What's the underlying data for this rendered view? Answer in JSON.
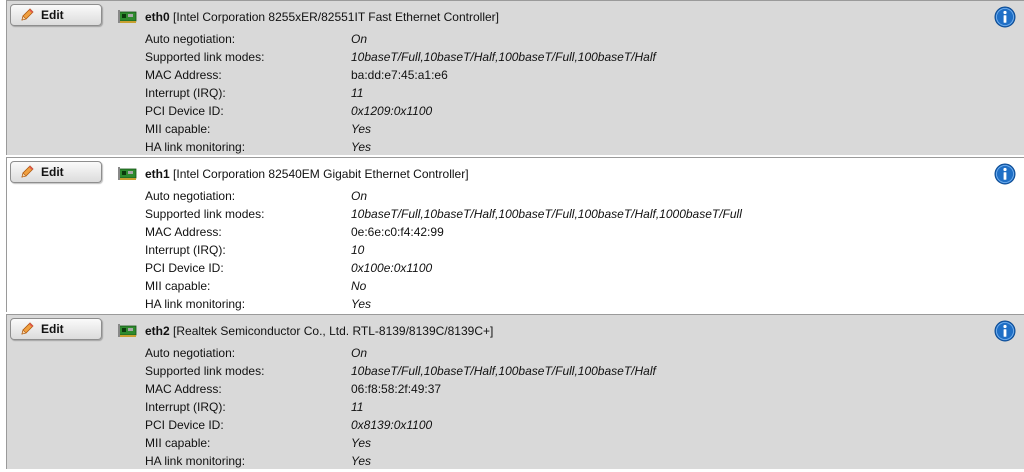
{
  "edit_label": "Edit",
  "property_labels": {
    "auto_negotiation": "Auto negotiation:",
    "supported_link_modes": "Supported link modes:",
    "mac_address": "MAC Address:",
    "irq": "Interrupt (IRQ):",
    "pci_device_id": "PCI Device ID:",
    "mii_capable": "MII capable:",
    "ha_link_monitoring": "HA link monitoring:"
  },
  "interfaces": [
    {
      "name": "eth0",
      "description": "[Intel Corporation 8255xER/82551IT Fast Ethernet Controller]",
      "auto_negotiation": "On",
      "supported_link_modes": "10baseT/Full,10baseT/Half,100baseT/Full,100baseT/Half",
      "mac_address": "ba:dd:e7:45:a1:e6",
      "irq": "11",
      "pci_device_id": "0x1209:0x1100",
      "mii_capable": "Yes",
      "ha_link_monitoring": "Yes"
    },
    {
      "name": "eth1",
      "description": "[Intel Corporation 82540EM Gigabit Ethernet Controller]",
      "auto_negotiation": "On",
      "supported_link_modes": "10baseT/Full,10baseT/Half,100baseT/Full,100baseT/Half,1000baseT/Full",
      "mac_address": "0e:6e:c0:f4:42:99",
      "irq": "10",
      "pci_device_id": "0x100e:0x1100",
      "mii_capable": "No",
      "ha_link_monitoring": "Yes"
    },
    {
      "name": "eth2",
      "description": "[Realtek Semiconductor Co., Ltd. RTL-8139/8139C/8139C+]",
      "auto_negotiation": "On",
      "supported_link_modes": "10baseT/Full,10baseT/Half,100baseT/Full,100baseT/Half",
      "mac_address": "06:f8:58:2f:49:37",
      "irq": "11",
      "pci_device_id": "0x8139:0x1100",
      "mii_capable": "Yes",
      "ha_link_monitoring": "Yes"
    }
  ],
  "colors": {
    "row_gray": "#d9d9d9",
    "row_white": "#ffffff",
    "info_blue": "#1f6fc6"
  },
  "icons": {
    "edit": "pencil-icon",
    "nic": "network-card-icon",
    "info": "info-icon"
  }
}
